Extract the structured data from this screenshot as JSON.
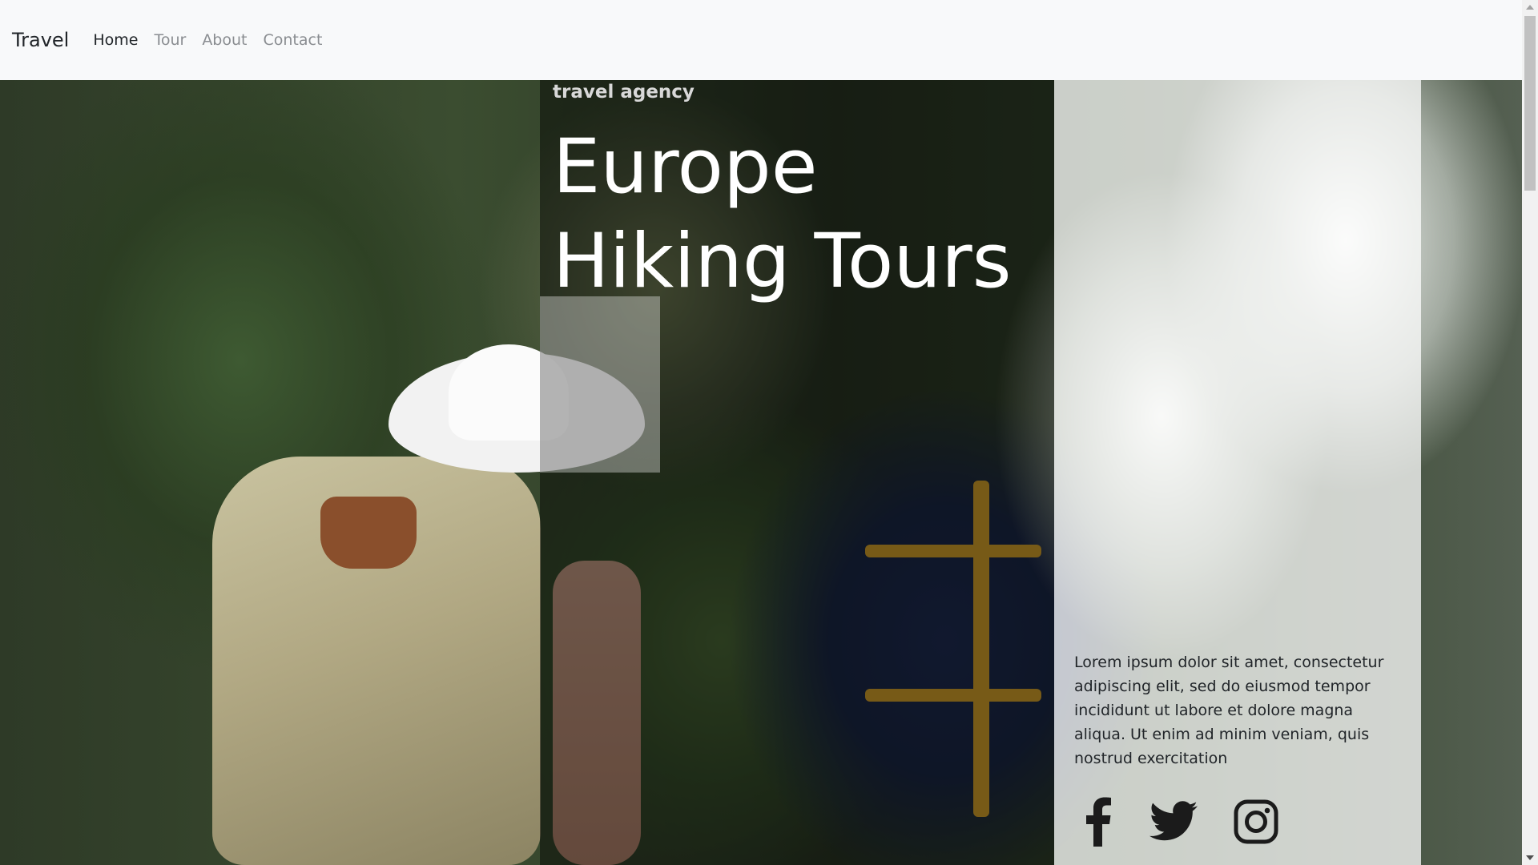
{
  "navbar": {
    "brand": "Travel",
    "links": [
      {
        "label": "Home",
        "active": true
      },
      {
        "label": "Tour",
        "active": false
      },
      {
        "label": "About",
        "active": false
      },
      {
        "label": "Contact",
        "active": false
      }
    ]
  },
  "hero": {
    "subtitle": "travel agency",
    "headline_line1": "Europe",
    "headline_line2": "Hiking Tours",
    "description": "Lorem ipsum dolor sit amet, consectetur adipiscing elit, sed do eiusmod tempor incididunt ut labore et dolore magna aliqua. Ut enim ad minim veniam, quis nostrud exercitation"
  },
  "social": {
    "icons": [
      "facebook-icon",
      "twitter-icon",
      "instagram-icon"
    ]
  },
  "colors": {
    "navbar_bg": "#f8f9fa",
    "nav_active": "#212529",
    "nav_inactive": "#8a8d91",
    "headline": "#ffffff",
    "icon": "#1b1b1b"
  }
}
